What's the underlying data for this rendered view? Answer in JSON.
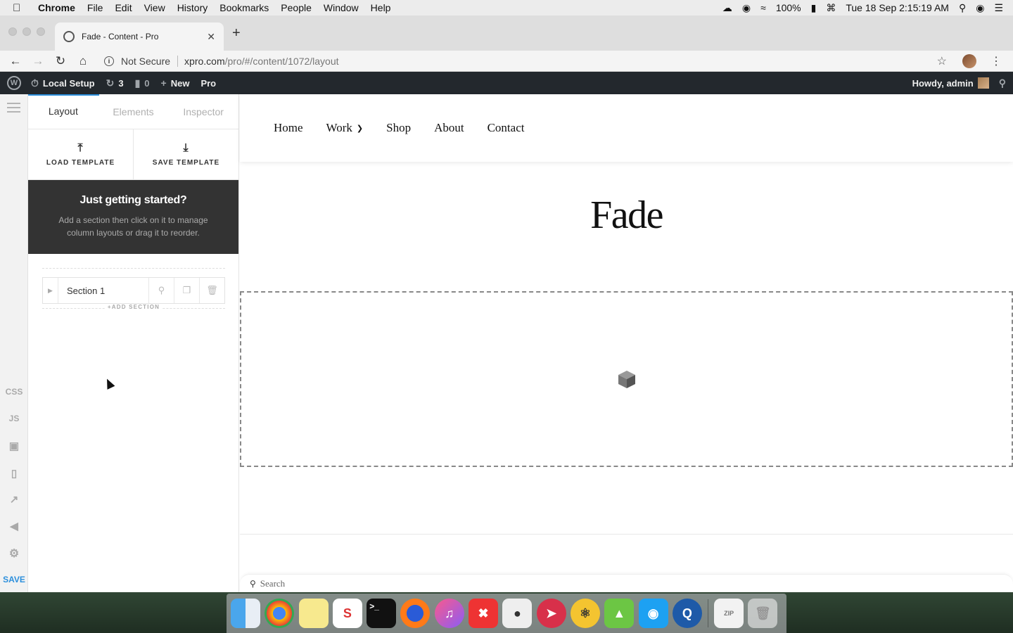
{
  "menubar": {
    "app_name": "Chrome",
    "items": [
      "File",
      "Edit",
      "View",
      "History",
      "Bookmarks",
      "People",
      "Window",
      "Help"
    ],
    "battery": "100%",
    "datetime": "Tue 18 Sep  2:15:19 AM"
  },
  "browser": {
    "tab_title": "Fade - Content - Pro",
    "security": "Not Secure",
    "url_host": "xpro.com",
    "url_path": "/pro/#/content/1072/layout"
  },
  "wpbar": {
    "site_name": "Local Setup",
    "updates_count": "3",
    "comments_count": "0",
    "new_label": "New",
    "pro_label": "Pro",
    "howdy": "Howdy, admin"
  },
  "rail": {
    "css": "CSS",
    "js": "JS",
    "save": "SAVE"
  },
  "panel": {
    "tabs": [
      "Layout",
      "Elements",
      "Inspector"
    ],
    "load_template": "LOAD TEMPLATE",
    "save_template": "SAVE TEMPLATE",
    "hint_title": "Just getting started?",
    "hint_body": "Add a section then click on it to manage column layouts or drag it to reorder.",
    "section_label": "Section 1",
    "add_section": "+ADD SECTION"
  },
  "preview": {
    "nav": [
      "Home",
      "Work",
      "Shop",
      "About",
      "Contact"
    ],
    "page_title": "Fade",
    "search_placeholder": "Search"
  },
  "colors": {
    "accent": "#2c8fdc",
    "wp_bar": "#23282d",
    "hint_bg": "#333333"
  }
}
